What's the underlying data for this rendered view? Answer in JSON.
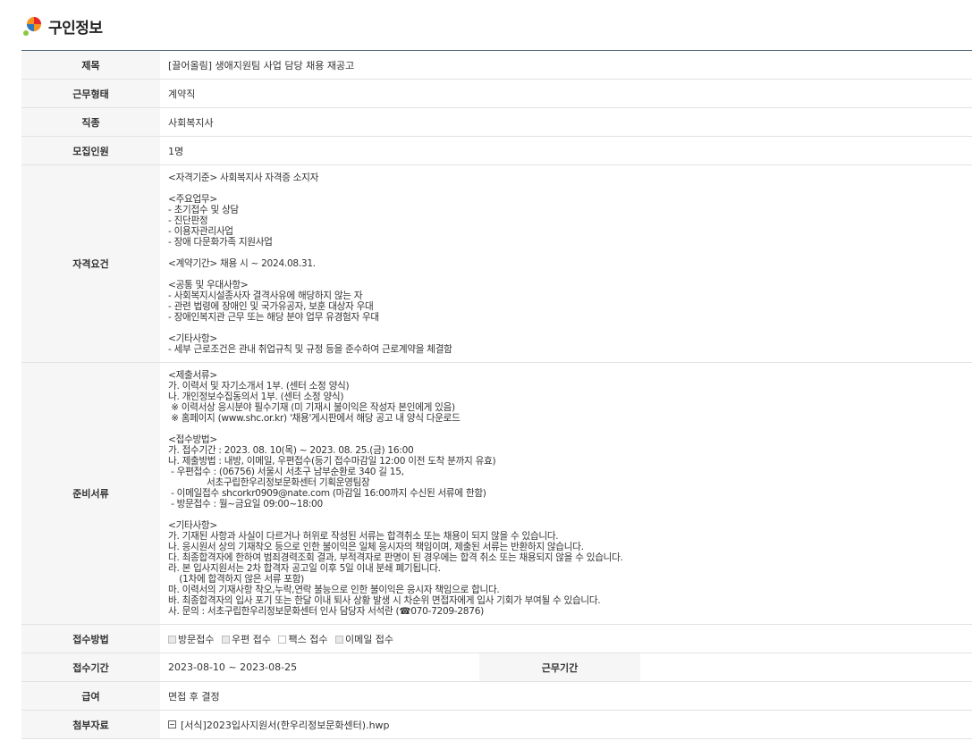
{
  "page": {
    "section_title": "구인정보"
  },
  "rows": {
    "title": {
      "label": "제목",
      "value": "[끌어올림] 생애지원팀 사업 담당 채용 재공고"
    },
    "work_type": {
      "label": "근무형태",
      "value": "계약직"
    },
    "job_type": {
      "label": "직종",
      "value": "사회복지사"
    },
    "headcount": {
      "label": "모집인원",
      "value": "1명"
    },
    "qualification": {
      "label": "자격요건",
      "value": "<자격기준> 사회복지사 자격증 소지자\n\n<주요업무>\n- 초기접수 및 상담\n- 진단판정\n- 이용자관리사업\n- 장애 다문화가족 지원사업\n\n<계약기간> 채용 시 ~ 2024.08.31.\n\n<공통 및 우대사항>\n- 사회복지시설종사자 결격사유에 해당하지 않는 자\n- 관련 법령에 장애인 및 국가유공자, 보훈 대상자 우대\n- 장애인복지관 근무 또는 해당 분야 업무 유경험자 우대\n\n<기타사항>\n- 세부 근로조건은 관내 취업규칙 및 규정 등을 준수하여 근로계약을 체결함"
    },
    "documents": {
      "label": "준비서류",
      "value": "<제출서류>\n가. 이력서 및 자기소개서 1부. (센터 소정 양식)\n나. 개인정보수집동의서 1부. (센터 소정 양식)\n ※ 이력서상 응시분야 필수기재 (미 기재시 불이익은 작성자 본인에게 있음)\n ※ 홈페이지 (www.shc.or.kr) '채용'게시판에서 해당 공고 내 양식 다운로드\n\n<접수방법>\n가. 접수기간 : 2023. 08. 10(목) ~ 2023. 08. 25.(금) 16:00\n나. 제출방법 : 내방, 이메일, 우편접수(등기 접수마감일 12:00 이전 도착 분까지 유효)\n - 우편접수 : (06756) 서울시 서초구 남부순환로 340 길 15,\n              서초구립한우리정보문화센터 기획운영팀장\n - 이메일접수 shcorkr0909@nate.com (마감일 16:00까지 수신된 서류에 한함)\n - 방문접수 : 월~금요일 09:00~18:00\n\n<기타사항>\n가. 기재된 사항과 사실이 다르거나 허위로 작성된 서류는 합격취소 또는 채용이 되지 않을 수 있습니다.\n나. 응시원서 상의 기재착오 등으로 인한 불이익은 일체 응시자의 책임이며, 제출된 서류는 반환하지 않습니다.\n다. 최종합격자에 한하여 범죄경력조회 결과, 부적격자로 판명이 된 경우에는 합격 취소 또는 채용되지 않을 수 있습니다.\n라. 본 입사지원서는 2차 합격자 공고일 이후 5일 이내 분쇄 폐기됩니다.\n    (1차에 합격하지 않은 서류 포함)\n마. 이력서의 기재사항 착오,누락,연락 불능으로 인한 불이익은 응시자 책임으로 합니다.\n바. 최종합격자의 입사 포기 또는 한달 이내 퇴사 상황 발생 시 차순위 면접자에게 입사 기회가 부여될 수 있습니다.\n사. 문의 : 서초구립한우리정보문화센터 인사 담당자 서석란 (☎070-7209-2876)"
    },
    "apply_method": {
      "label": "접수방법",
      "options": [
        {
          "label": "방문접수",
          "checked": true
        },
        {
          "label": "우편 접수",
          "checked": true
        },
        {
          "label": "팩스 접수",
          "checked": false
        },
        {
          "label": "이메일 접수",
          "checked": true
        }
      ]
    },
    "period": {
      "label": "접수기간",
      "value": "2023-08-10 ~ 2023-08-25",
      "work_period_label": "근무기간",
      "work_period_value": ""
    },
    "salary": {
      "label": "급여",
      "value": "면접 후 결정"
    },
    "attachment": {
      "label": "첨부자료",
      "file_name": "[서식]2023입사지원서(한우리정보문화센터).hwp",
      "icon": "file-icon"
    }
  }
}
